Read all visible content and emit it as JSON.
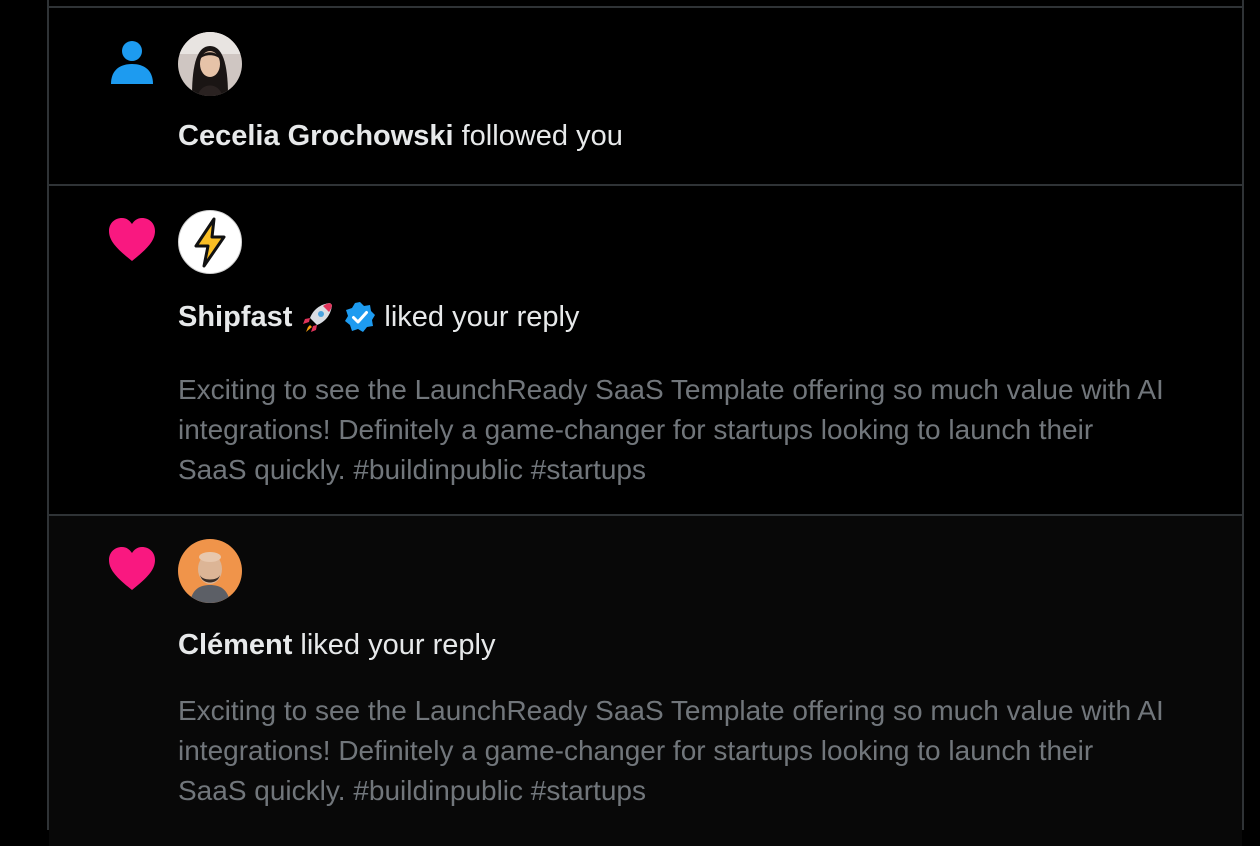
{
  "notifications": [
    {
      "type_icon": "person-icon",
      "avatar": "user-photo-avatar",
      "name": "Cecelia Grochowski",
      "action": "followed you"
    },
    {
      "type_icon": "heart-icon",
      "avatar": "lightning-bolt-avatar",
      "name": "Shipfast",
      "emoji": "rocket-emoji",
      "verified": "verified-badge-icon",
      "action": "liked your reply",
      "text": "Exciting to see the LaunchReady SaaS Template offering so much value with AI integrations! Definitely a game-changer for startups looking to launch their SaaS quickly. #buildinpublic #startups"
    },
    {
      "type_icon": "heart-icon",
      "avatar": "user-photo-avatar",
      "name": "Clément",
      "action": "liked your reply",
      "text": "Exciting to see the LaunchReady SaaS Template offering so much value with AI integrations! Definitely a game-changer for startups looking to launch their SaaS quickly. #buildinpublic #startups"
    }
  ],
  "colors": {
    "background": "#000000",
    "border": "#2f3336",
    "primary_text": "#e7e9ea",
    "secondary_text": "#71767b",
    "follow_icon": "#1d9bf0",
    "like_icon": "#f91880",
    "verified_badge": "#1d9bf0"
  }
}
